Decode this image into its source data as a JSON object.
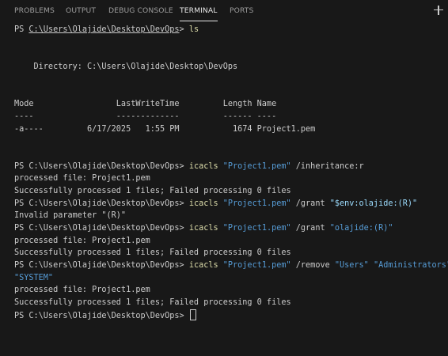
{
  "tabs": [
    {
      "label": "PROBLEMS",
      "active": false
    },
    {
      "label": "OUTPUT",
      "active": false
    },
    {
      "label": "DEBUG CONSOLE",
      "active": false
    },
    {
      "label": "TERMINAL",
      "active": true
    },
    {
      "label": "PORTS",
      "active": false
    }
  ],
  "new_terminal_icon": "plus-icon",
  "colors": {
    "background": "#181818",
    "text": "#cccccc",
    "command": "#dcdcaa",
    "string": "#569cd6",
    "variable": "#9cdcfe"
  },
  "terminal": {
    "prompt": "PS C:\\Users\\Olajide\\Desktop\\DevOps> ",
    "prompt_prefix": "PS ",
    "prompt_path": "C:\\Users\\Olajide\\Desktop\\DevOps",
    "prompt_suffix": "> ",
    "ls_command": "ls",
    "directory_line": "    Directory: C:\\Users\\Olajide\\Desktop\\DevOps",
    "listing_header": "Mode                 LastWriteTime         Length Name",
    "listing_rule": "----                 -------------         ------ ----",
    "listing_row": "-a----         6/17/2025   1:55 PM           1674 Project1.pem",
    "commands": [
      {
        "tool": "icacls",
        "file": "\"Project1.pem\"",
        "switch": "/inheritance:r",
        "args": []
      },
      {
        "tool": "icacls",
        "file": "\"Project1.pem\"",
        "switch": "/grant",
        "args": [
          "\"$env:olajide:(R)\""
        ]
      },
      {
        "tool": "icacls",
        "file": "\"Project1.pem\"",
        "switch": "/grant",
        "args": [
          "\"olajide:(R)\""
        ]
      },
      {
        "tool": "icacls",
        "file": "\"Project1.pem\"",
        "switch": "/remove",
        "args": [
          "\"Users\"",
          "\"Administrators\""
        ],
        "wrapped_arg": "\"SYSTEM\""
      }
    ],
    "processed_line": "processed file: Project1.pem",
    "success_line": "Successfully processed 1 files; Failed processing 0 files",
    "invalid_param_line": "Invalid parameter \"(R)\""
  }
}
